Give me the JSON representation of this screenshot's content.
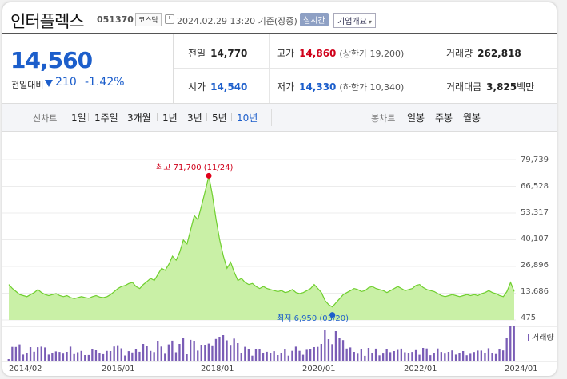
{
  "header": {
    "name": "인터플렉스",
    "code": "051370",
    "market": "코스닥",
    "datetime": "2024.02.29 13:20  기준(장중)",
    "realtime": "실시간",
    "company_button": "기업개요"
  },
  "quote": {
    "price": "14,560",
    "change_label": "전일대비",
    "change_value": "210",
    "change_pct": "-1.42%",
    "prev_close_label": "전일",
    "prev_close": "14,770",
    "high_label": "고가",
    "high": "14,860",
    "upper_limit": "(상한가 19,200)",
    "volume_label": "거래량",
    "volume": "262,818",
    "open_label": "시가",
    "open": "14,540",
    "low_label": "저가",
    "low": "14,330",
    "lower_limit": "(하한가 10,340)",
    "amount_label": "거래대금",
    "amount": "3,825",
    "amount_unit": "백만"
  },
  "toolbar": {
    "line_chart_label": "선차트",
    "periods": [
      "1일",
      "1주일",
      "3개월",
      "1년",
      "3년",
      "5년",
      "10년"
    ],
    "active_period": "10년",
    "candle_label": "봉차트",
    "candles": [
      "일봉",
      "주봉",
      "월봉"
    ]
  },
  "colors": {
    "accent_blue": "#1c5ecb",
    "up_red": "#d0021b",
    "line_green": "#6fcf2e",
    "volume_purple": "#7a5db6"
  },
  "chart_data": {
    "type": "area",
    "y_ticks": [
      "79,739",
      "66,528",
      "53,317",
      "40,107",
      "26,896",
      "13,686",
      "475"
    ],
    "ylim": [
      475,
      79739
    ],
    "x_ticks": [
      "2014/02",
      "2016/01",
      "2018/01",
      "2020/01",
      "2022/01",
      "2024/01"
    ],
    "high_annotation": "최고 71,700 (11/24)",
    "low_annotation": "최저 6,950 (03/20)",
    "volume_legend": "거래량",
    "series": [
      {
        "values": [
          18000,
          16000,
          14500,
          13000,
          12500,
          12000,
          13000,
          14000,
          15500,
          14000,
          13000,
          12500,
          13000,
          13500,
          12500,
          12000,
          12500,
          11500,
          11000,
          11500,
          12000,
          11500,
          11200,
          12000,
          12500,
          11800,
          11500,
          12000,
          13000,
          14500,
          16000,
          17000,
          17500,
          18500,
          19000,
          17000,
          16000,
          18000,
          19500,
          21000,
          20000,
          23000,
          26000,
          25000,
          28000,
          32000,
          30000,
          34000,
          40000,
          38000,
          45000,
          52000,
          50000,
          57000,
          64000,
          71700,
          62000,
          50000,
          40000,
          32000,
          26000,
          29000,
          24000,
          20000,
          21000,
          19000,
          18000,
          18500,
          17000,
          16000,
          17000,
          16000,
          15500,
          15000,
          14500,
          15000,
          14000,
          14500,
          15500,
          14000,
          13500,
          14000,
          15000,
          16000,
          18000,
          16000,
          14000,
          10000,
          8000,
          6950,
          9000,
          11000,
          13000,
          14000,
          15000,
          16000,
          15500,
          14500,
          15000,
          16500,
          17000,
          16000,
          15500,
          15000,
          14000,
          15000,
          16000,
          17000,
          16000,
          15000,
          15500,
          16000,
          17500,
          18000,
          16500,
          15500,
          15000,
          14500,
          13500,
          12500,
          12000,
          12500,
          13000,
          12500,
          12000,
          12500,
          13000,
          12500,
          13000,
          12500,
          13500,
          14000,
          15000,
          14000,
          13500,
          12500,
          12000,
          14500,
          19000,
          14560
        ]
      }
    ]
  }
}
